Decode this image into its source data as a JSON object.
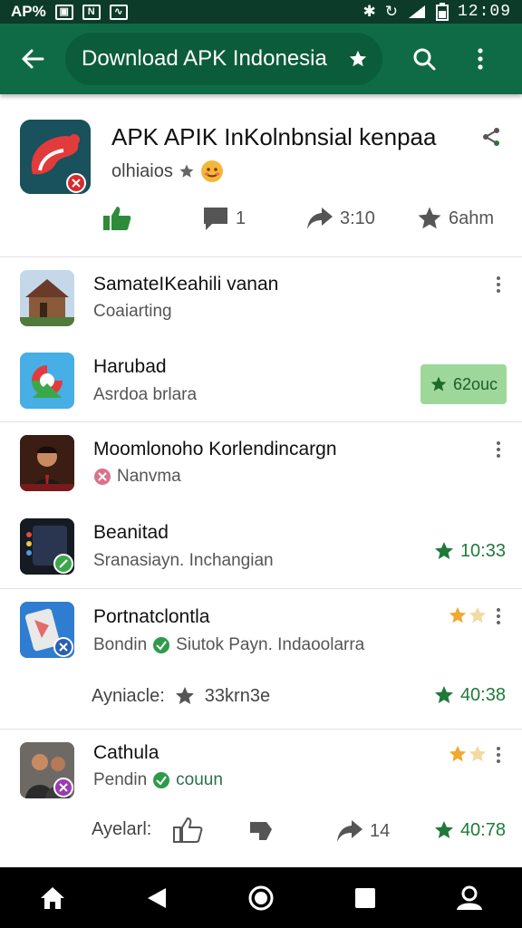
{
  "status_bar": {
    "carrier": "AP%",
    "time": "12:09"
  },
  "app_bar": {
    "title": "Download APK Indonesia"
  },
  "app_header": {
    "title": "APK APIK InKolnbnsial kenpaa",
    "subtitle": "olhiaios",
    "stats": {
      "like_count": "",
      "comments": "1",
      "shares": "3:10",
      "rating": "6ahm"
    }
  },
  "list": [
    {
      "title": "SamateIKeahili vanan",
      "subtitle": "Coaiarting"
    },
    {
      "title": "Harubad",
      "subtitle": "Asrdoa brlara",
      "chip_label": "62ouc"
    },
    {
      "title": "Moomlonoho Korlendincargn",
      "subtitle": "Nanvma"
    },
    {
      "title": "Beanitad",
      "subtitle": "Sranasiayn. Inchangian",
      "rating": "10:33"
    },
    {
      "title": "Portnatclontla",
      "subtitle_prefix": "Bondin",
      "subtitle": "Siutok Payn. Indaoolarra",
      "meta_label": "Ayniacle:",
      "meta_value": "33krn3e",
      "rating": "40:38"
    },
    {
      "title": "Cathula",
      "subtitle_prefix": "Pendin",
      "subtitle": "couun",
      "meta_label": "Ayelarl:",
      "meta_shares": "14",
      "rating": "40:78"
    }
  ],
  "colors": {
    "app_bar": "#0f6b46",
    "status_bar": "#0d3b2a",
    "accent_green": "#1f7a3a",
    "star_gold": "#f0a830"
  }
}
